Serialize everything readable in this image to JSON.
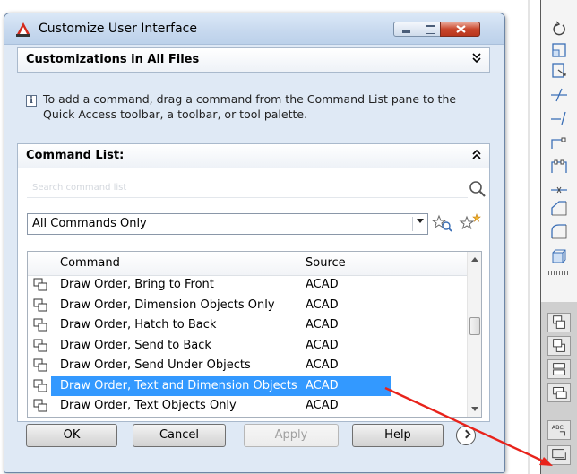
{
  "window": {
    "title": "Customize User Interface"
  },
  "panels": {
    "customizations": {
      "label": "Customizations in All Files",
      "collapse_glyph": "»"
    },
    "info": {
      "text": "To add a command, drag a command from the Command List pane to the Quick Access toolbar, a toolbar, or tool palette."
    },
    "command_list": {
      "label": "Command List:",
      "collapse_glyph": "«"
    }
  },
  "search": {
    "placeholder": "Search command list"
  },
  "filter": {
    "selected": "All Commands Only"
  },
  "grid": {
    "columns": [
      "Command",
      "Source"
    ],
    "rows": [
      {
        "name": "Draw Order, Bring to Front",
        "source": "ACAD",
        "icon": "bring-to-front-icon"
      },
      {
        "name": "Draw Order, Dimension Objects Only",
        "source": "ACAD",
        "icon": "dimension-order-icon"
      },
      {
        "name": "Draw Order, Hatch to Back",
        "source": "ACAD",
        "icon": "hatch-to-back-icon"
      },
      {
        "name": "Draw Order, Send to Back",
        "source": "ACAD",
        "icon": "send-to-back-icon"
      },
      {
        "name": "Draw Order, Send Under Objects",
        "source": "ACAD",
        "icon": "send-under-icon"
      },
      {
        "name": "Draw Order, Text and Dimension Objects",
        "source": "ACAD",
        "icon": "text-dimension-icon",
        "selected": true
      },
      {
        "name": "Draw Order, Text Objects Only",
        "source": "ACAD",
        "icon": "text-order-icon"
      }
    ]
  },
  "buttons": {
    "ok": "OK",
    "cancel": "Cancel",
    "apply": "Apply",
    "help": "Help"
  },
  "colors": {
    "selection": "#3399ff",
    "arrow": "#e8231b",
    "close_button": "#c9462c"
  }
}
